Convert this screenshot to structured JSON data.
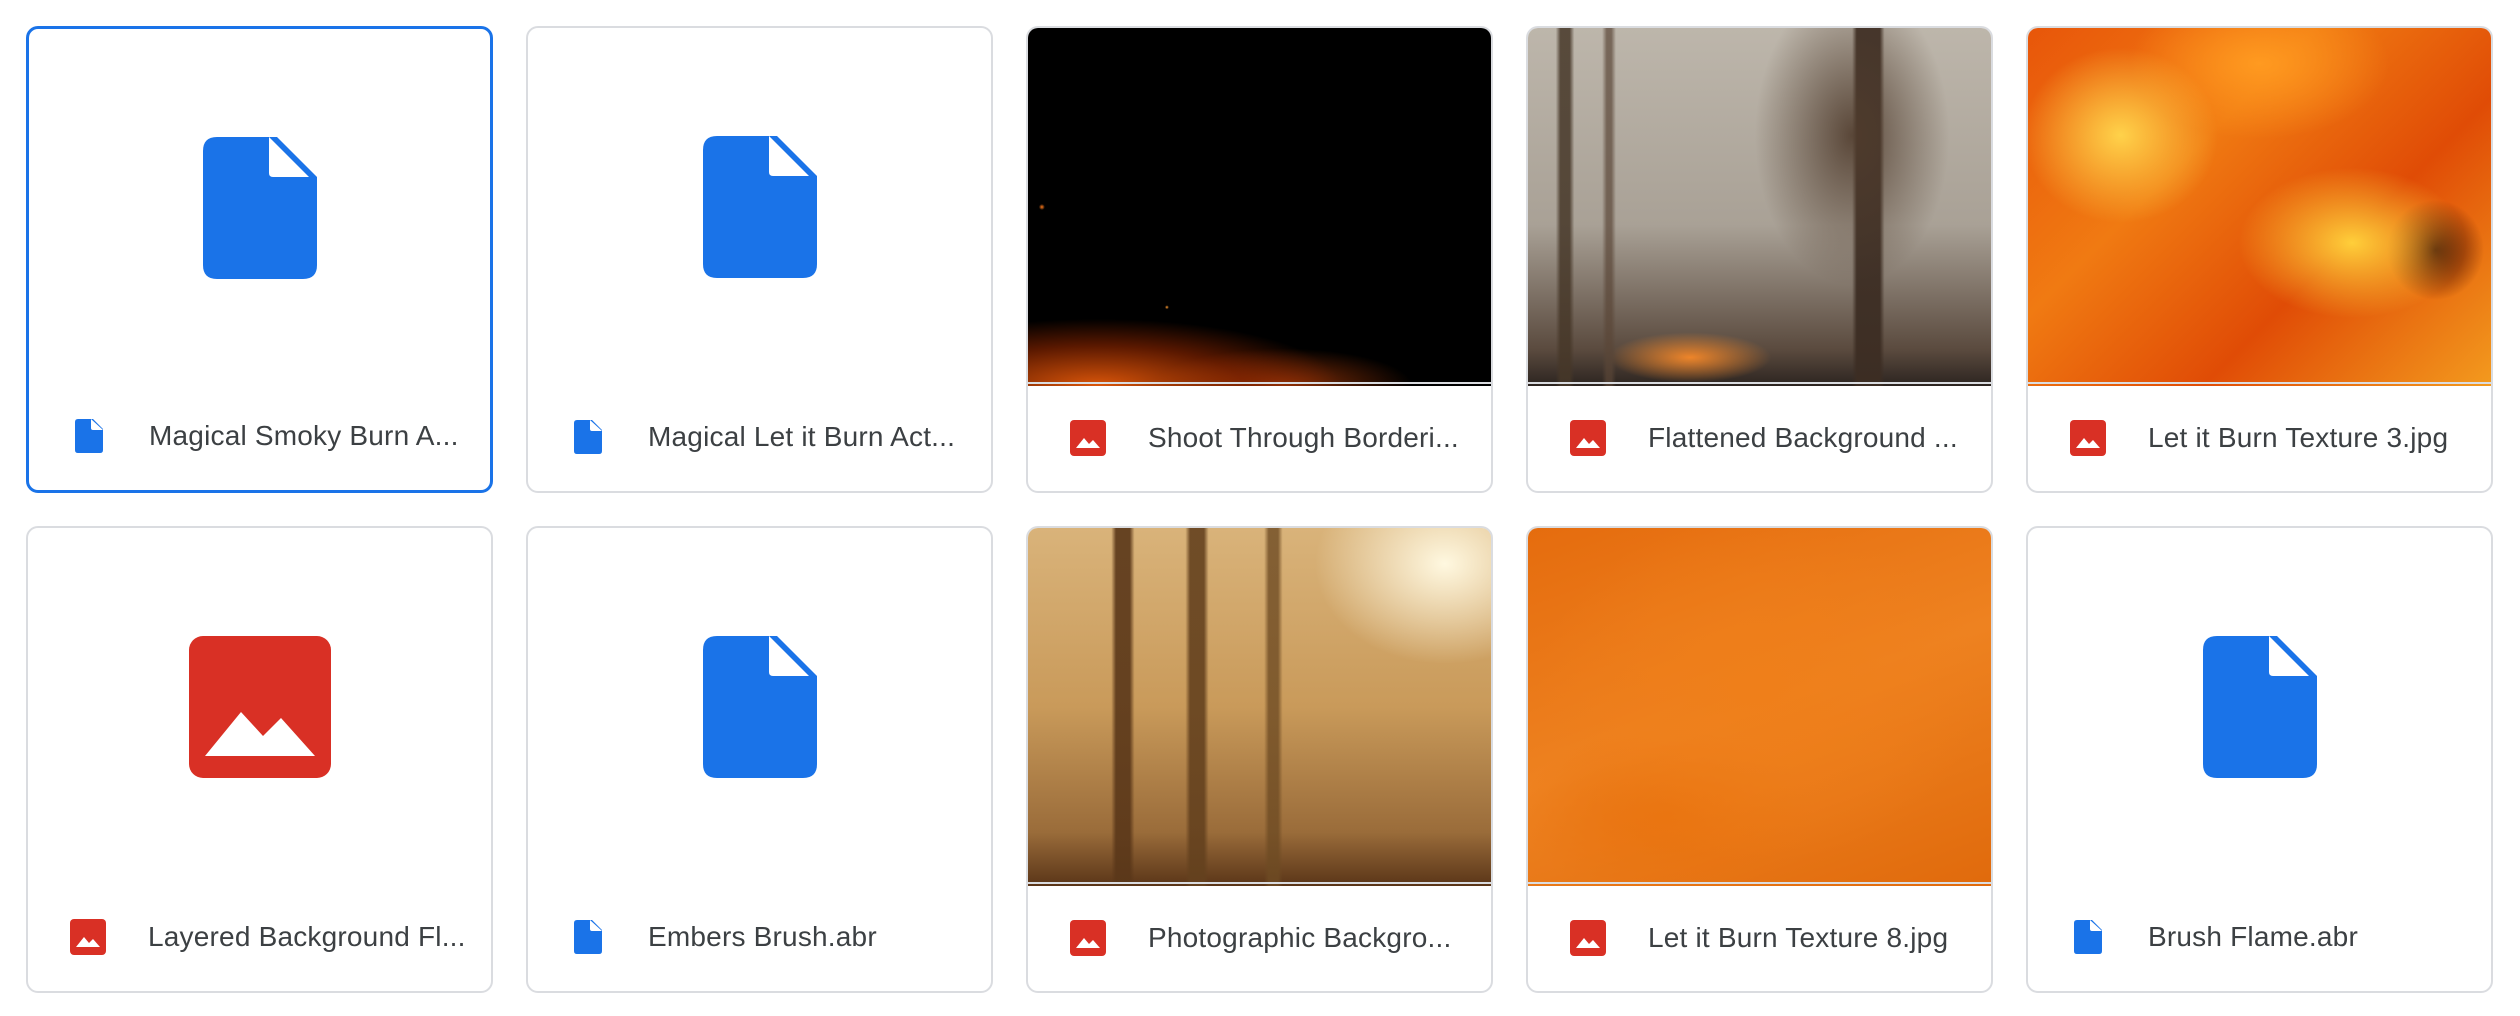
{
  "colors": {
    "doc_blue": "#1a73e8",
    "image_red": "#d93025",
    "selected_border": "#1a73e8",
    "card_border": "#dadce0",
    "text": "#3c4043"
  },
  "files": [
    {
      "name": "Magical Smoky Burn A...",
      "type": "document",
      "icon": "document-icon",
      "thumbnail": "document-icon",
      "selected": true
    },
    {
      "name": "Magical Let it Burn Act...",
      "type": "document",
      "icon": "document-icon",
      "thumbnail": "document-icon",
      "selected": false
    },
    {
      "name": "Shoot Through Borderi...",
      "type": "image",
      "icon": "image-icon",
      "thumbnail": "photo-black-with-embers",
      "selected": false
    },
    {
      "name": "Flattened Background ...",
      "type": "image",
      "icon": "image-icon",
      "thumbnail": "photo-smoky-forest-fire",
      "selected": false
    },
    {
      "name": "Let it Burn Texture 3.jpg",
      "type": "image",
      "icon": "image-icon",
      "thumbnail": "photo-flames",
      "selected": false
    },
    {
      "name": "Layered Background Fl...",
      "type": "image",
      "icon": "image-icon",
      "thumbnail": "image-icon",
      "selected": false
    },
    {
      "name": "Embers Brush.abr",
      "type": "document",
      "icon": "document-icon",
      "thumbnail": "document-icon",
      "selected": false
    },
    {
      "name": "Photographic Backgro...",
      "type": "image",
      "icon": "image-icon",
      "thumbnail": "photo-sunlit-forest-fire",
      "selected": false
    },
    {
      "name": "Let it Burn Texture 8.jpg",
      "type": "image",
      "icon": "image-icon",
      "thumbnail": "photo-orange-texture",
      "selected": false
    },
    {
      "name": "Brush Flame.abr",
      "type": "document",
      "icon": "document-icon",
      "thumbnail": "document-icon",
      "selected": false
    }
  ]
}
